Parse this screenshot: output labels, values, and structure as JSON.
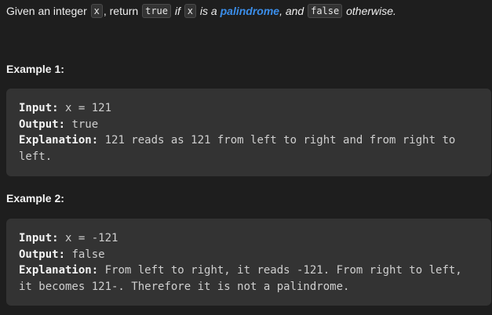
{
  "description": {
    "part1": "Given an integer ",
    "code_x": "x",
    "part2": ", return ",
    "code_true": "true",
    "part3": " if ",
    "code_x2": "x",
    "part4": " is a ",
    "link_palindrome": "palindrome",
    "part5": ", and ",
    "code_false": "false",
    "part6": " otherwise."
  },
  "examples": [
    {
      "heading": "Example 1:",
      "input_label": "Input:",
      "input_value": " x = 121",
      "output_label": "Output:",
      "output_value": " true",
      "explanation_label": "Explanation:",
      "explanation_value": " 121 reads as 121 from left to right and from right to left."
    },
    {
      "heading": "Example 2:",
      "input_label": "Input:",
      "input_value": " x = -121",
      "output_label": "Output:",
      "output_value": " false",
      "explanation_label": "Explanation:",
      "explanation_value": " From left to right, it reads -121. From right to left, it becomes 121-. Therefore it is not a palindrome."
    }
  ],
  "colors": {
    "background": "#1e1e1e",
    "code_block_bg": "#333333",
    "link": "#3b8eea"
  }
}
